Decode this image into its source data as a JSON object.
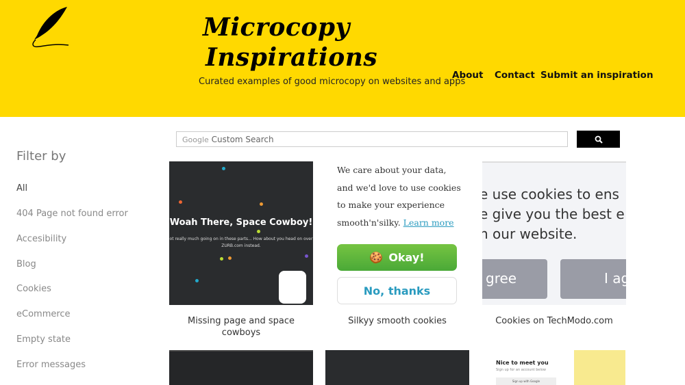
{
  "header": {
    "title_line1": "Microcopy",
    "title_line2": "Inspirations",
    "tagline": "Curated examples of good microcopy on websites and apps",
    "bg_color": "#ffd900",
    "nav": [
      {
        "label": "About"
      },
      {
        "label": "Contact"
      },
      {
        "label": "Submit an inspiration"
      }
    ]
  },
  "sidebar": {
    "title": "Filter by",
    "items": [
      {
        "label": "All"
      },
      {
        "label": "404 Page not found error"
      },
      {
        "label": "Accesibility"
      },
      {
        "label": "Blog"
      },
      {
        "label": "Cookies"
      },
      {
        "label": "eCommerce"
      },
      {
        "label": "Empty state"
      },
      {
        "label": "Error messages"
      }
    ]
  },
  "search": {
    "brand": "Google",
    "placeholder": "Custom Search",
    "icon": "search-icon"
  },
  "cards": [
    {
      "caption": "Missing page and space cowboys",
      "heading": "Woah There, Space Cowboy!",
      "body": "ot really much going on in these parts... How about you head on over",
      "body2": "ZURB.com instead."
    },
    {
      "caption": "Silkyy smooth cookies",
      "text": "We care about your data, and we'd love to use cookies to make your experience smooth'n'silky.",
      "link": "Learn more",
      "ok": "Okay!",
      "no": "No, thanks"
    },
    {
      "caption": "Cookies on TechModo.com",
      "line1": "e use cookies to ens",
      "line2": "e give you the best e",
      "line3": "n our website.",
      "btn1": "gree",
      "btn2": "I ag"
    }
  ],
  "row2": {
    "card3_title": "Nice to meet you",
    "card3_sub": "Sign up for an account below",
    "card3_btn": "Sign up with Google"
  }
}
